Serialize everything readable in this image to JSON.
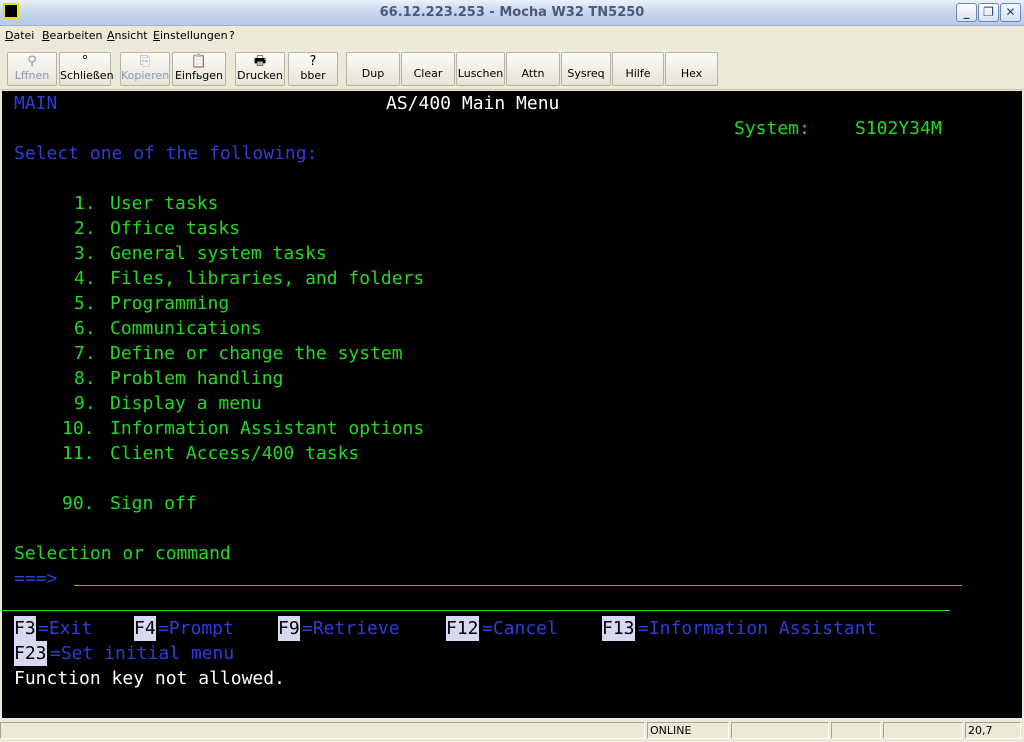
{
  "window": {
    "title": "66.12.223.253 - Mocha W32 TN5250",
    "controls": [
      "_",
      "❐",
      "✕"
    ]
  },
  "menubar": [
    "Datei",
    "Bearbeiten",
    "Ansicht",
    "Einstellungen",
    "?"
  ],
  "toolbar": [
    {
      "label": "Lffnen",
      "icon": "⚲"
    },
    {
      "label": "Schließen",
      "icon": "°"
    },
    {
      "label": "Kopieren",
      "icon": "⎘"
    },
    {
      "label": "Einfьgen",
      "icon": "📋"
    },
    {
      "label": "Drucken",
      "icon": "🖶"
    },
    {
      "label": "bber",
      "icon": "?"
    },
    {
      "label": "Dup"
    },
    {
      "label": "Clear"
    },
    {
      "label": "Luschen"
    },
    {
      "label": "Attn"
    },
    {
      "label": "Sysreq"
    },
    {
      "label": "Hilfe"
    },
    {
      "label": "Hex"
    }
  ],
  "screen": {
    "menu_id": "MAIN",
    "title": "AS/400 Main Menu",
    "system_label": "System:",
    "system_name": "S102Y34M",
    "prompt": "Select one of the following:",
    "options": [
      {
        "num": "1.",
        "text": "User tasks"
      },
      {
        "num": "2.",
        "text": "Office tasks"
      },
      {
        "num": "3.",
        "text": "General system tasks"
      },
      {
        "num": "4.",
        "text": "Files, libraries, and folders"
      },
      {
        "num": "5.",
        "text": "Programming"
      },
      {
        "num": "6.",
        "text": "Communications"
      },
      {
        "num": "7.",
        "text": "Define or change the system"
      },
      {
        "num": "8.",
        "text": "Problem handling"
      },
      {
        "num": "9.",
        "text": "Display a menu"
      },
      {
        "num": "10.",
        "text": "Information Assistant options"
      },
      {
        "num": "11.",
        "text": "Client Access/400 tasks"
      }
    ],
    "signoff": {
      "num": "90.",
      "text": "Sign off"
    },
    "selection_label": "Selection or command",
    "command_prompt": "===>",
    "command_value": "",
    "function_keys": [
      {
        "key": "F3",
        "label": "=Exit"
      },
      {
        "key": "F4",
        "label": "=Prompt"
      },
      {
        "key": "F9",
        "label": "=Retrieve"
      },
      {
        "key": "F12",
        "label": "=Cancel"
      },
      {
        "key": "F13",
        "label": "=Information Assistant"
      },
      {
        "key": "F23",
        "label": "=Set initial menu"
      }
    ],
    "message": "Function key not allowed."
  },
  "statusbar": {
    "connection": "ONLINE",
    "cursor_position": "20,7"
  },
  "colors": {
    "field_green": "#22d922",
    "label_blue": "#2b3fd6",
    "message_white": "#ffffff",
    "screen_bg": "#000000"
  }
}
